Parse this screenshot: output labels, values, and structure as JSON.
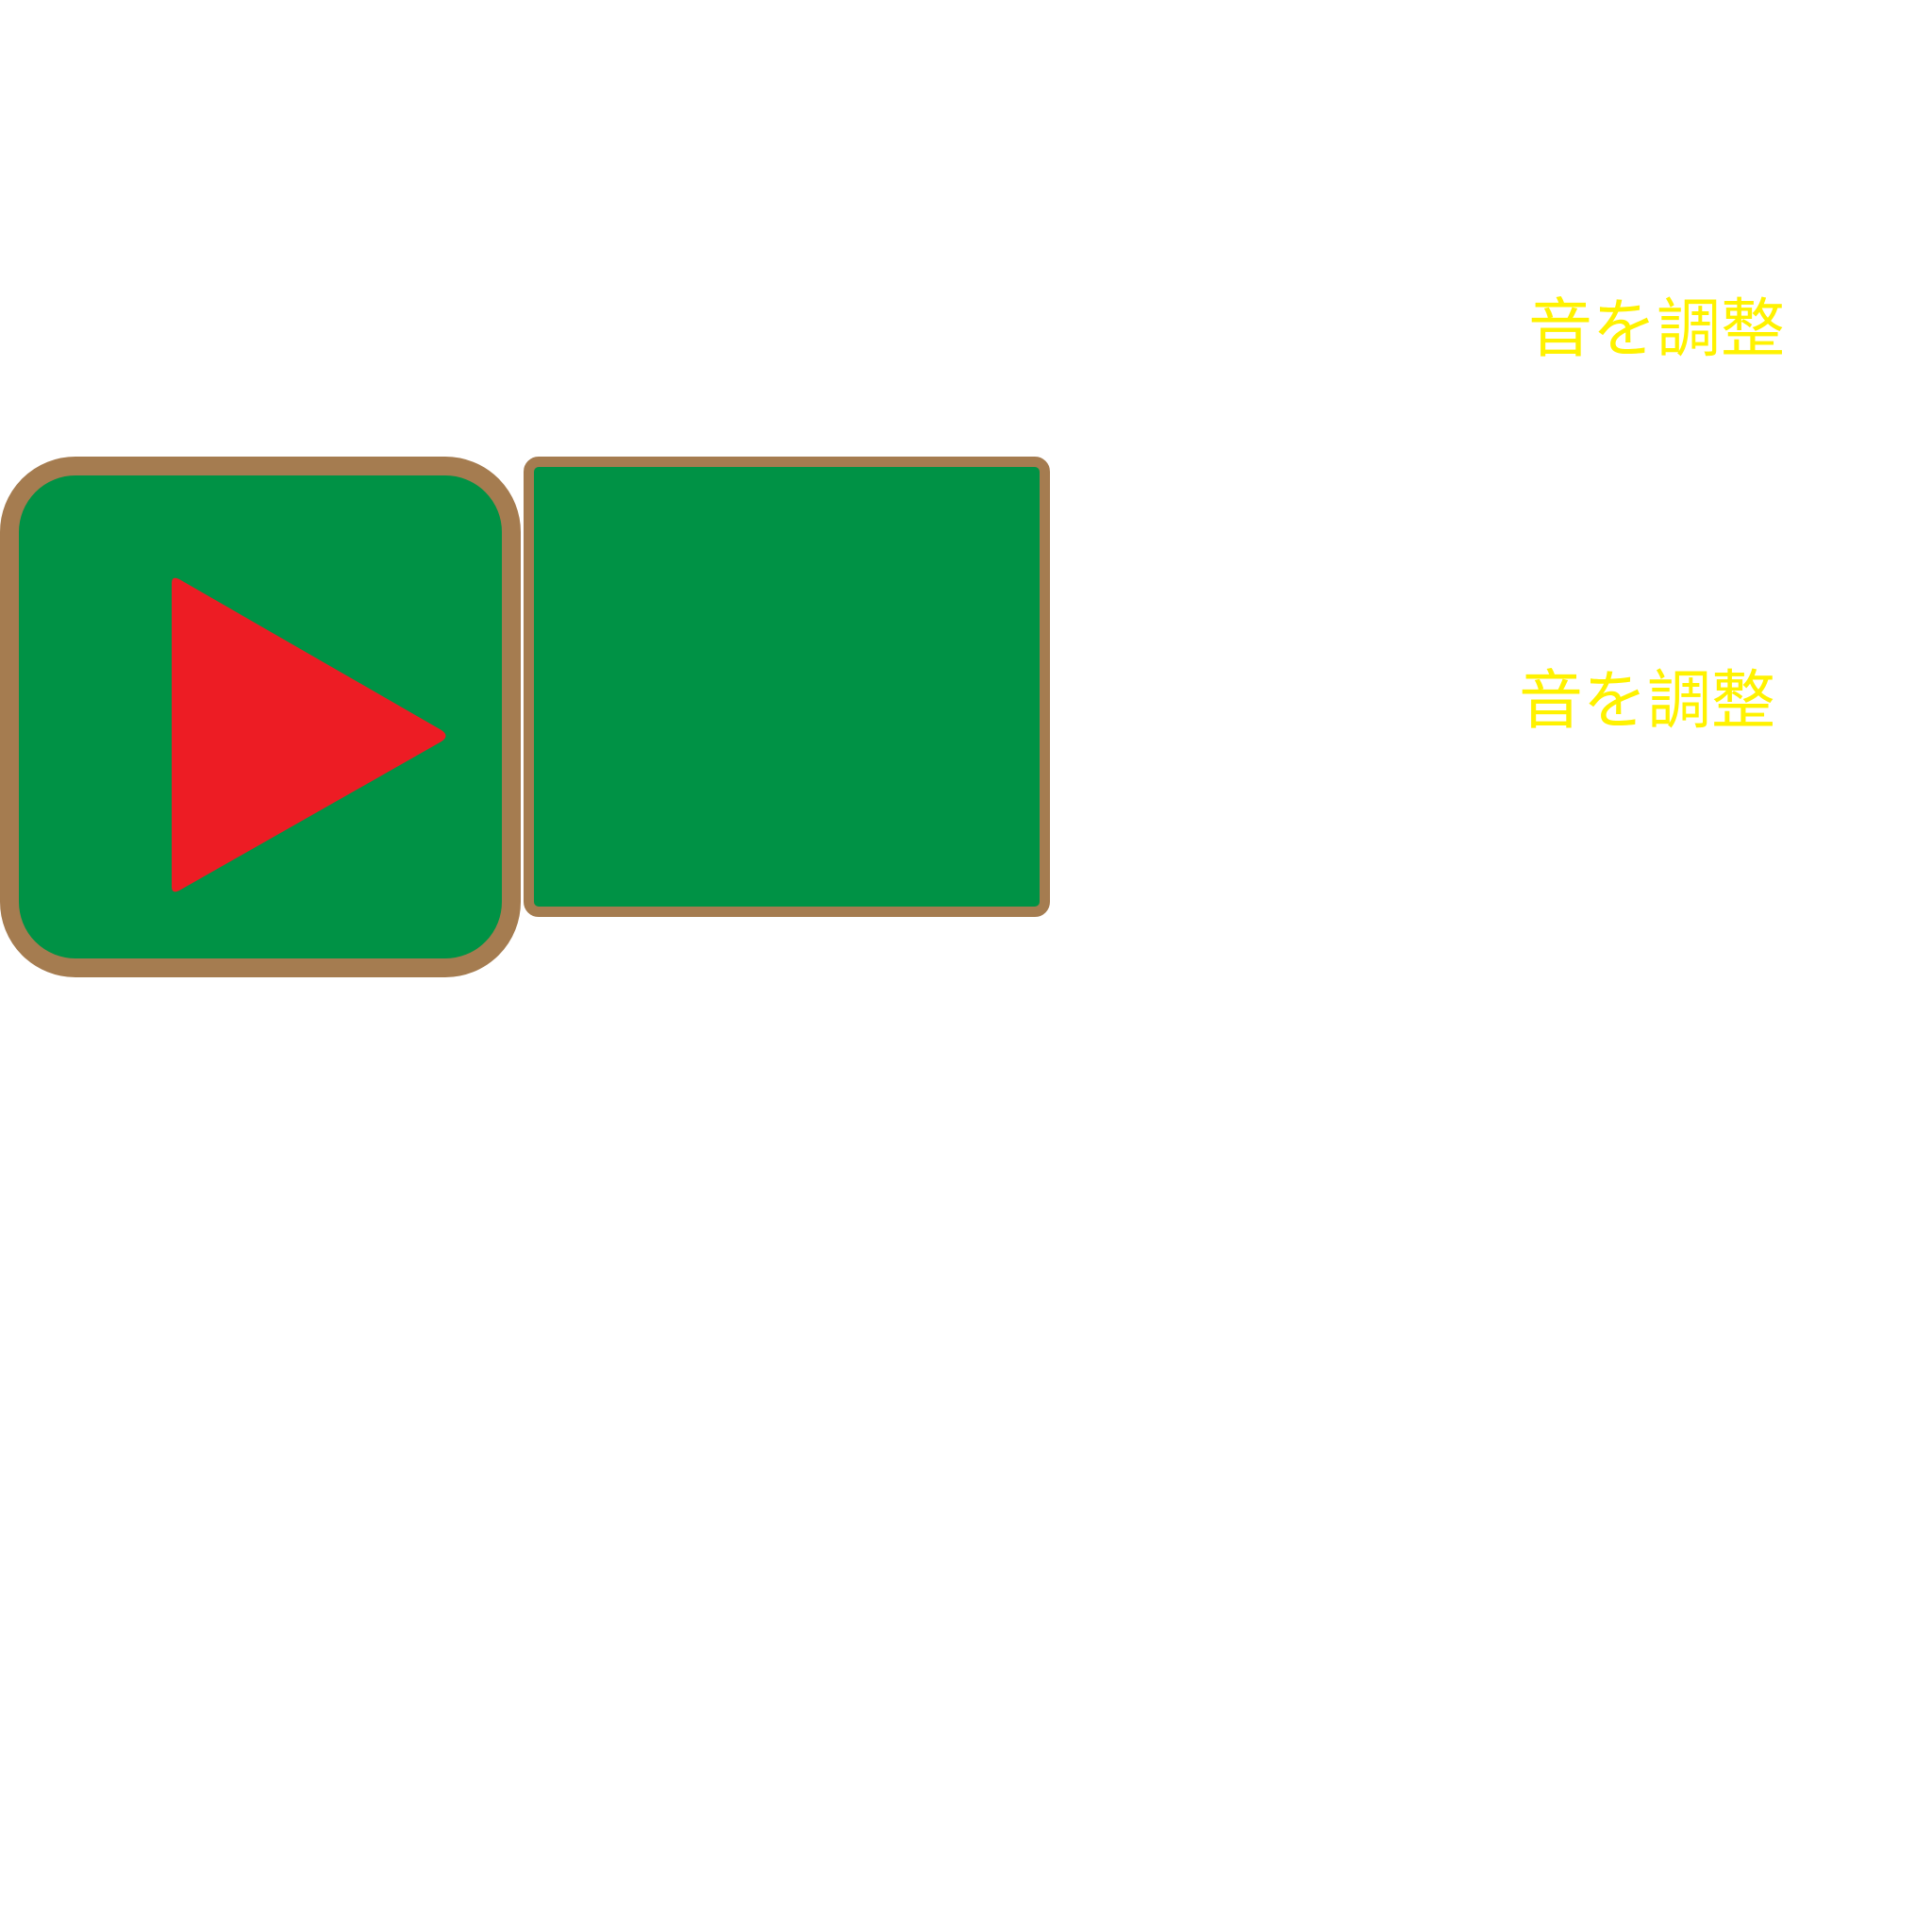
{
  "colors": {
    "background": "#ffffff",
    "button_fill": "#009245",
    "button_border": "#a57c50",
    "play_icon": "#ed1c24",
    "label_text": "#fff200"
  },
  "controls": {
    "play_button": {
      "icon": "play-icon"
    },
    "second_button": {
      "icon": ""
    }
  },
  "labels": {
    "adjust_sound_1": "音を調整",
    "adjust_sound_2": "音を調整"
  }
}
